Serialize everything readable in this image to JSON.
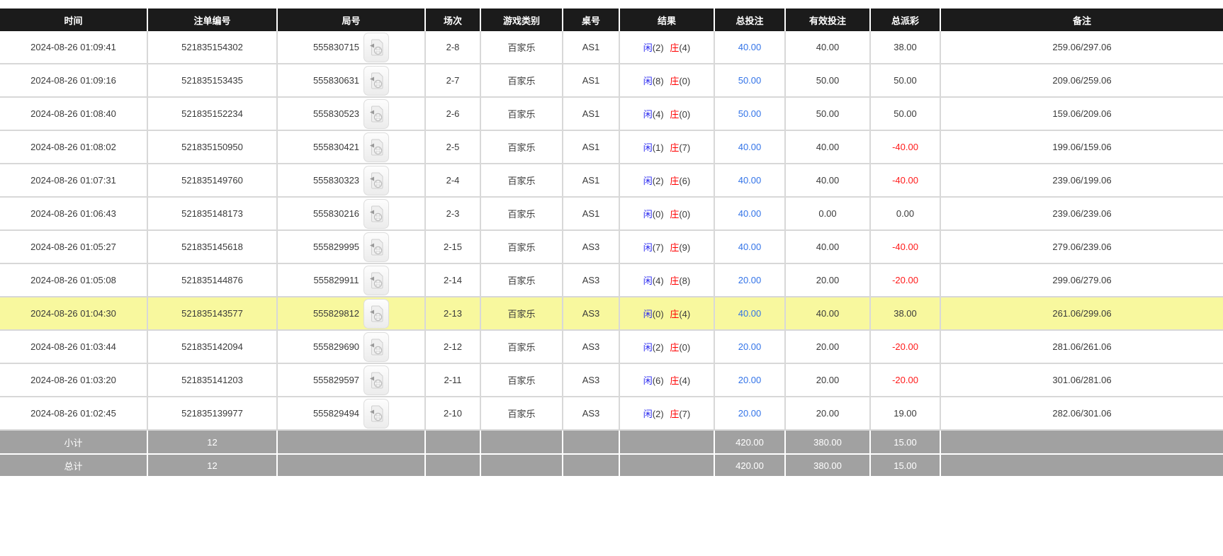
{
  "colors": {
    "header_bg": "#1b1b1b",
    "summary_bg": "#a1a1a1",
    "highlight": "#f8f89e",
    "border": "#d8d8d8",
    "link_blue": "#3273e8",
    "xian_blue": "#2b2bf0",
    "zhuang_red": "#ff0000",
    "negative_red": "#ff1a1a"
  },
  "table": {
    "headers": [
      "时间",
      "注单编号",
      "局号",
      "场次",
      "游戏类别",
      "桌号",
      "结果",
      "总投注",
      "有效投注",
      "总派彩",
      "备注"
    ],
    "rows": [
      {
        "time": "2024-08-26 01:09:41",
        "bet_id": "521835154302",
        "round": "555830715",
        "session": "2-8",
        "game": "百家乐",
        "table_no": "AS1",
        "result": {
          "xian": "闲(2)",
          "zhuang": "庄(4)"
        },
        "total_bet": "40.00",
        "valid_bet": "40.00",
        "payout": "38.00",
        "remark": "259.06/297.06",
        "highlighted": false
      },
      {
        "time": "2024-08-26 01:09:16",
        "bet_id": "521835153435",
        "round": "555830631",
        "session": "2-7",
        "game": "百家乐",
        "table_no": "AS1",
        "result": {
          "xian": "闲(8)",
          "zhuang": "庄(0)"
        },
        "total_bet": "50.00",
        "valid_bet": "50.00",
        "payout": "50.00",
        "remark": "209.06/259.06",
        "highlighted": false
      },
      {
        "time": "2024-08-26 01:08:40",
        "bet_id": "521835152234",
        "round": "555830523",
        "session": "2-6",
        "game": "百家乐",
        "table_no": "AS1",
        "result": {
          "xian": "闲(4)",
          "zhuang": "庄(0)"
        },
        "total_bet": "50.00",
        "valid_bet": "50.00",
        "payout": "50.00",
        "remark": "159.06/209.06",
        "highlighted": false
      },
      {
        "time": "2024-08-26 01:08:02",
        "bet_id": "521835150950",
        "round": "555830421",
        "session": "2-5",
        "game": "百家乐",
        "table_no": "AS1",
        "result": {
          "xian": "闲(1)",
          "zhuang": "庄(7)"
        },
        "total_bet": "40.00",
        "valid_bet": "40.00",
        "payout": "-40.00",
        "remark": "199.06/159.06",
        "highlighted": false
      },
      {
        "time": "2024-08-26 01:07:31",
        "bet_id": "521835149760",
        "round": "555830323",
        "session": "2-4",
        "game": "百家乐",
        "table_no": "AS1",
        "result": {
          "xian": "闲(2)",
          "zhuang": "庄(6)"
        },
        "total_bet": "40.00",
        "valid_bet": "40.00",
        "payout": "-40.00",
        "remark": "239.06/199.06",
        "highlighted": false
      },
      {
        "time": "2024-08-26 01:06:43",
        "bet_id": "521835148173",
        "round": "555830216",
        "session": "2-3",
        "game": "百家乐",
        "table_no": "AS1",
        "result": {
          "xian": "闲(0)",
          "zhuang": "庄(0)"
        },
        "total_bet": "40.00",
        "valid_bet": "0.00",
        "payout": "0.00",
        "remark": "239.06/239.06",
        "highlighted": false
      },
      {
        "time": "2024-08-26 01:05:27",
        "bet_id": "521835145618",
        "round": "555829995",
        "session": "2-15",
        "game": "百家乐",
        "table_no": "AS3",
        "result": {
          "xian": "闲(7)",
          "zhuang": "庄(9)"
        },
        "total_bet": "40.00",
        "valid_bet": "40.00",
        "payout": "-40.00",
        "remark": "279.06/239.06",
        "highlighted": false
      },
      {
        "time": "2024-08-26 01:05:08",
        "bet_id": "521835144876",
        "round": "555829911",
        "session": "2-14",
        "game": "百家乐",
        "table_no": "AS3",
        "result": {
          "xian": "闲(4)",
          "zhuang": "庄(8)"
        },
        "total_bet": "20.00",
        "valid_bet": "20.00",
        "payout": "-20.00",
        "remark": "299.06/279.06",
        "highlighted": false
      },
      {
        "time": "2024-08-26 01:04:30",
        "bet_id": "521835143577",
        "round": "555829812",
        "session": "2-13",
        "game": "百家乐",
        "table_no": "AS3",
        "result": {
          "xian": "闲(0)",
          "zhuang": "庄(4)"
        },
        "total_bet": "40.00",
        "valid_bet": "40.00",
        "payout": "38.00",
        "remark": "261.06/299.06",
        "highlighted": true
      },
      {
        "time": "2024-08-26 01:03:44",
        "bet_id": "521835142094",
        "round": "555829690",
        "session": "2-12",
        "game": "百家乐",
        "table_no": "AS3",
        "result": {
          "xian": "闲(2)",
          "zhuang": "庄(0)"
        },
        "total_bet": "20.00",
        "valid_bet": "20.00",
        "payout": "-20.00",
        "remark": "281.06/261.06",
        "highlighted": false
      },
      {
        "time": "2024-08-26 01:03:20",
        "bet_id": "521835141203",
        "round": "555829597",
        "session": "2-11",
        "game": "百家乐",
        "table_no": "AS3",
        "result": {
          "xian": "闲(6)",
          "zhuang": "庄(4)"
        },
        "total_bet": "20.00",
        "valid_bet": "20.00",
        "payout": "-20.00",
        "remark": "301.06/281.06",
        "highlighted": false
      },
      {
        "time": "2024-08-26 01:02:45",
        "bet_id": "521835139977",
        "round": "555829494",
        "session": "2-10",
        "game": "百家乐",
        "table_no": "AS3",
        "result": {
          "xian": "闲(2)",
          "zhuang": "庄(7)"
        },
        "total_bet": "20.00",
        "valid_bet": "20.00",
        "payout": "19.00",
        "remark": "282.06/301.06",
        "highlighted": false
      }
    ],
    "summary": [
      {
        "label": "小计",
        "count": "12",
        "total_bet": "420.00",
        "valid_bet": "380.00",
        "payout": "15.00",
        "remark": ""
      },
      {
        "label": "总计",
        "count": "12",
        "total_bet": "420.00",
        "valid_bet": "380.00",
        "payout": "15.00",
        "remark": ""
      }
    ]
  }
}
